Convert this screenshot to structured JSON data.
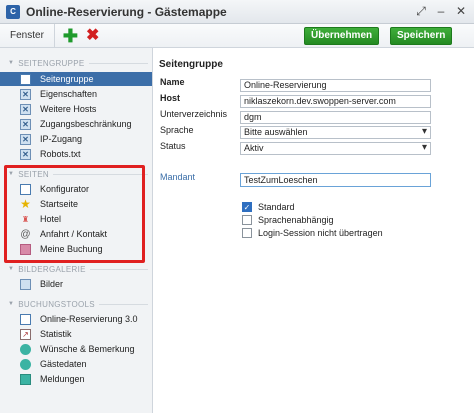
{
  "window": {
    "title": "Online-Reservierung - Gästemappe",
    "app_icon": "C"
  },
  "toolbar": {
    "menu": "Fenster",
    "apply_label": "Übernehmen",
    "save_label": "Speichern"
  },
  "sidebar": {
    "groups": [
      {
        "label": "SEITENGRUPPE",
        "items": [
          {
            "label": "Seitengruppe",
            "icon": "document-icon",
            "active": true
          },
          {
            "label": "Eigenschaften",
            "icon": "settings-icon"
          },
          {
            "label": "Weitere Hosts",
            "icon": "hosts-icon"
          },
          {
            "label": "Zugangsbeschränkung",
            "icon": "lock-icon"
          },
          {
            "label": "IP-Zugang",
            "icon": "ip-icon"
          },
          {
            "label": "Robots.txt",
            "icon": "robots-icon"
          }
        ]
      },
      {
        "label": "SEITEN",
        "items": [
          {
            "label": "Konfigurator",
            "icon": "configurator-icon"
          },
          {
            "label": "Startseite",
            "icon": "star-icon"
          },
          {
            "label": "Hotel",
            "icon": "hotel-icon"
          },
          {
            "label": "Anfahrt / Kontakt",
            "icon": "at-icon"
          },
          {
            "label": "Meine Buchung",
            "icon": "booking-icon"
          }
        ]
      },
      {
        "label": "BILDERGALERIE",
        "items": [
          {
            "label": "Bilder",
            "icon": "image-icon"
          }
        ]
      },
      {
        "label": "BUCHUNGSTOOLS",
        "items": [
          {
            "label": "Online-Reservierung 3.0",
            "icon": "reservation-icon"
          },
          {
            "label": "Statistik",
            "icon": "chart-icon"
          },
          {
            "label": "Wünsche & Bemerkung",
            "icon": "wishes-icon"
          },
          {
            "label": "Gästedaten",
            "icon": "guest-icon"
          },
          {
            "label": "Meldungen",
            "icon": "messages-icon"
          }
        ]
      }
    ]
  },
  "form": {
    "section_title": "Seitengruppe",
    "name_label": "Name",
    "name_value": "Online-Reservierung",
    "host_label": "Host",
    "host_value": "niklaszekorn.dev.swoppen-server.com",
    "dir_label": "Unterverzeichnis",
    "dir_value": "dgm",
    "lang_label": "Sprache",
    "lang_value": "Bitte auswählen",
    "status_label": "Status",
    "status_value": "Aktiv",
    "mandant_label": "Mandant",
    "mandant_value": "TestZumLoeschen",
    "checkboxes": [
      {
        "label": "Standard",
        "checked": true
      },
      {
        "label": "Sprachenabhängig",
        "checked": false
      },
      {
        "label": "Login-Session nicht übertragen",
        "checked": false
      }
    ]
  }
}
